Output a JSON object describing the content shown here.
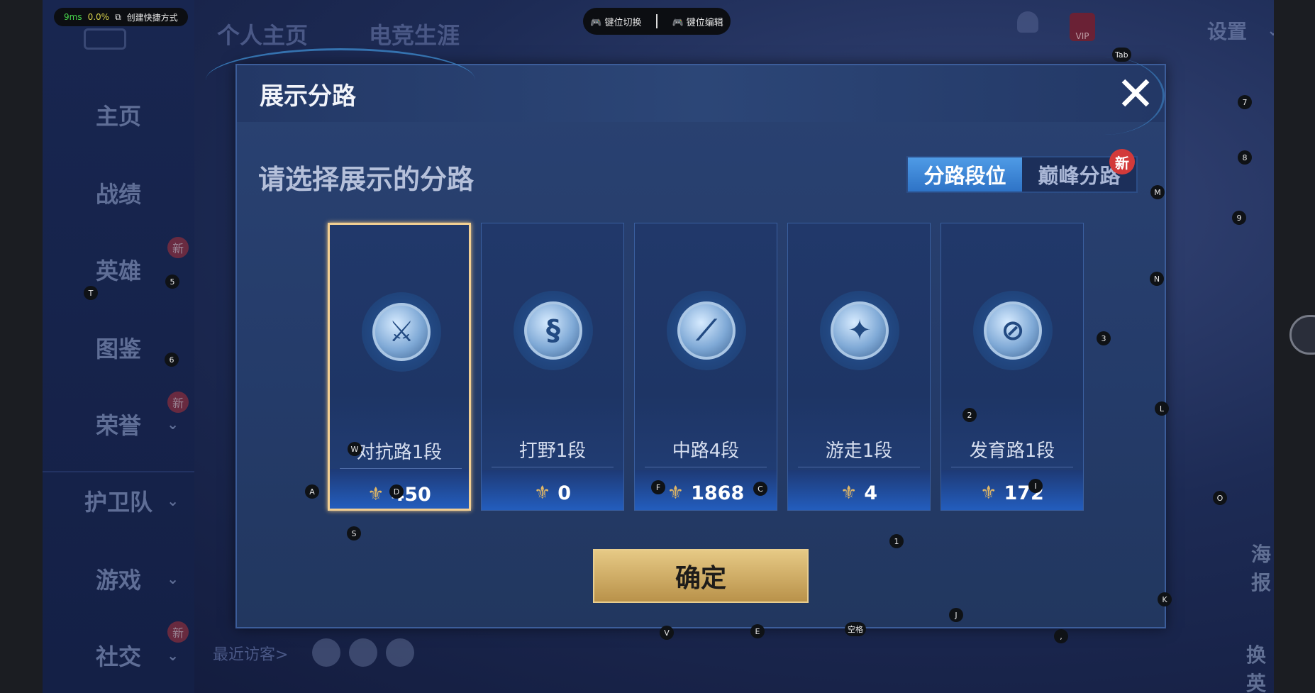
{
  "overlay": {
    "ping_ms": "9ms",
    "loss": "0.0%",
    "shortcut_label": "创建快捷方式",
    "key_switch": "键位切换",
    "key_edit": "键位编辑"
  },
  "header": {
    "tabs": [
      "个人主页",
      "电竞生涯"
    ],
    "settings_label": "设置"
  },
  "sidebar": {
    "items": [
      {
        "label": "主页"
      },
      {
        "label": "战绩"
      },
      {
        "label": "英雄"
      },
      {
        "label": "图鉴"
      },
      {
        "label": "荣誉"
      },
      {
        "label": "护卫队"
      },
      {
        "label": "游戏"
      },
      {
        "label": "社交"
      }
    ],
    "new_badge": "新"
  },
  "footer": {
    "recent_visitors": "最近访客>",
    "poster": "海报",
    "swap_hero": "换英雄"
  },
  "modal": {
    "title": "展示分路",
    "prompt": "请选择展示的分路",
    "toggle": {
      "options": [
        "分路段位",
        "巅峰分路"
      ],
      "active": 0,
      "new_badge": "新"
    },
    "cards": [
      {
        "label": "对抗路1段",
        "score": "450",
        "icon": "sword-icon",
        "selected": true
      },
      {
        "label": "打野1段",
        "score": "0",
        "icon": "dragon-icon",
        "selected": false
      },
      {
        "label": "中路4段",
        "score": "1868",
        "icon": "staff-icon",
        "selected": false
      },
      {
        "label": "游走1段",
        "score": "4",
        "icon": "wings-icon",
        "selected": false
      },
      {
        "label": "发育路1段",
        "score": "172",
        "icon": "bow-icon",
        "selected": false
      }
    ],
    "confirm_label": "确定"
  },
  "key_hints": [
    "Tab",
    "7",
    "8",
    "M",
    "9",
    "N",
    "T",
    "5",
    "6",
    "3",
    "L",
    "2",
    "W",
    "A",
    "D",
    "F",
    "C",
    "I",
    "O",
    "S",
    "1",
    "K",
    "J",
    "V",
    "E",
    "空格",
    ","
  ]
}
